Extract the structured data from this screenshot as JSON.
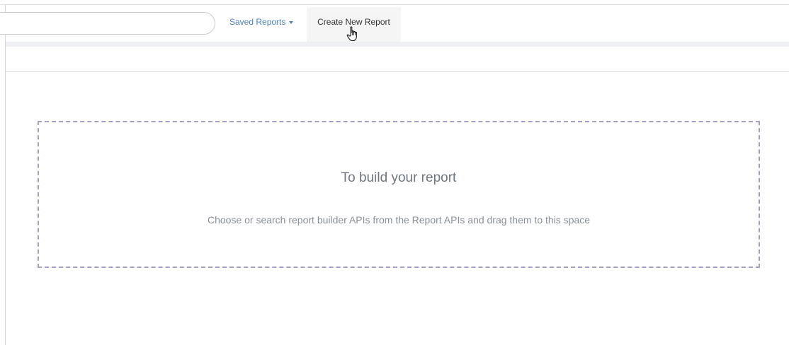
{
  "toolbar": {
    "search_placeholder": "",
    "saved_reports_label": "Saved Reports",
    "create_new_report_label": "Create New Report"
  },
  "dropzone": {
    "title": "To build your report",
    "subtitle": "Choose or search report builder APIs from the Report APIs and drag them to this space"
  },
  "colors": {
    "link": "#4a83b8",
    "dropzone_border": "#a49ec4",
    "active_tab_bg": "#f5f5f5"
  },
  "icons": {
    "saved_reports_caret": "caret-down-icon",
    "cursor": "hand-pointer-icon"
  }
}
